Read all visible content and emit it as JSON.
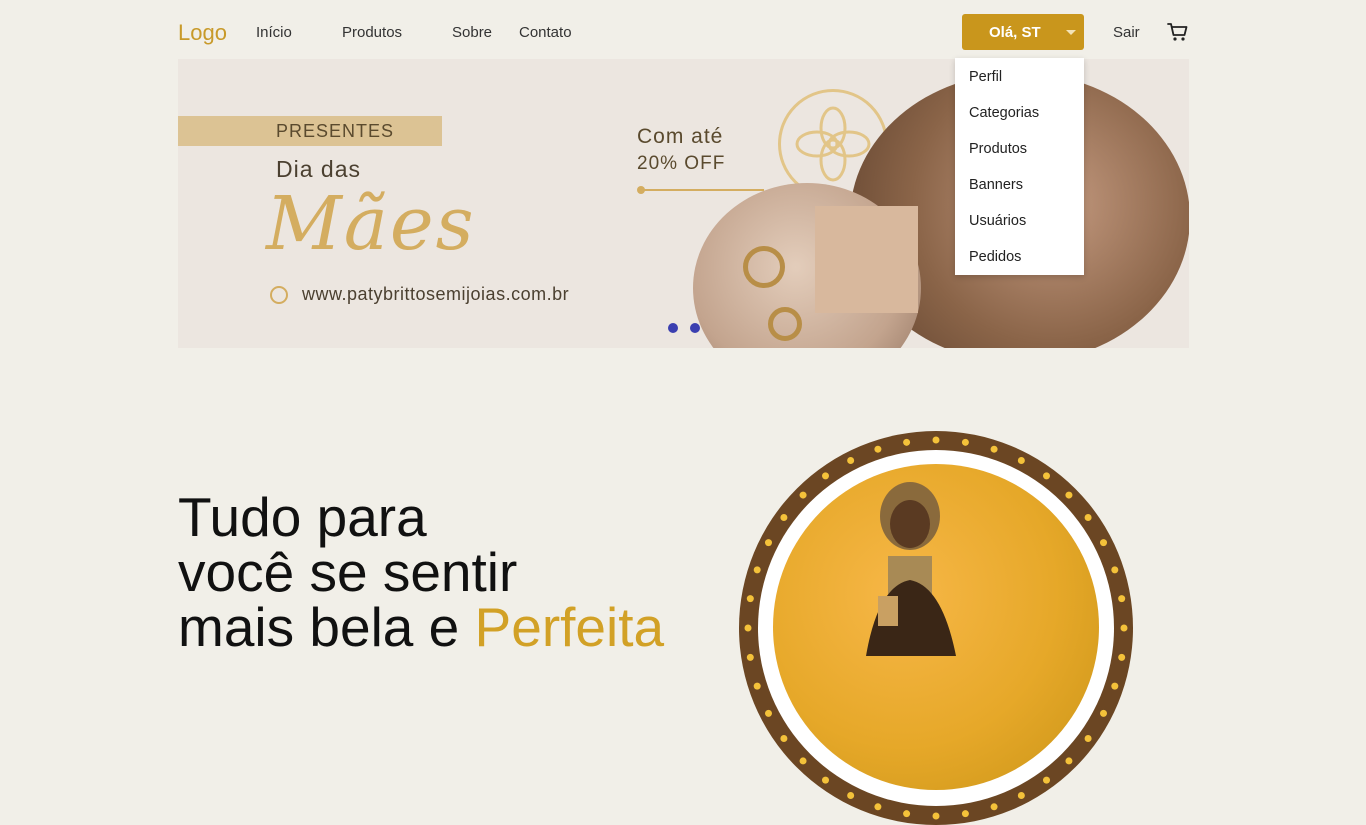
{
  "nav": {
    "logo": "Logo",
    "links": [
      "Início",
      "Produtos",
      "Sobre",
      "Contato"
    ],
    "user_button": "Olá, ST",
    "logout": "Sair",
    "cart_icon": "cart-icon"
  },
  "dropdown": {
    "items": [
      "Perfil",
      "Categorias",
      "Produtos",
      "Banners",
      "Usuários",
      "Pedidos"
    ]
  },
  "banner": {
    "ribbon": "PRESENTES",
    "line1": "Dia das",
    "line2": "Mães",
    "promo_line1": "Com até",
    "promo_line2": "20% OFF",
    "website": "www.patybrittosemijoias.com.br",
    "slide_count": 2,
    "colors": {
      "gold": "#d4ad60",
      "dot": "#3b3fb0"
    }
  },
  "hero": {
    "line1": "Tudo para",
    "line2": "você se sentir",
    "line3_prefix": "mais bela e ",
    "line3_accent": "Perfeita"
  },
  "colors": {
    "background": "#f1efe8",
    "accent": "#c9961c",
    "hero_accent": "#d2a126"
  }
}
